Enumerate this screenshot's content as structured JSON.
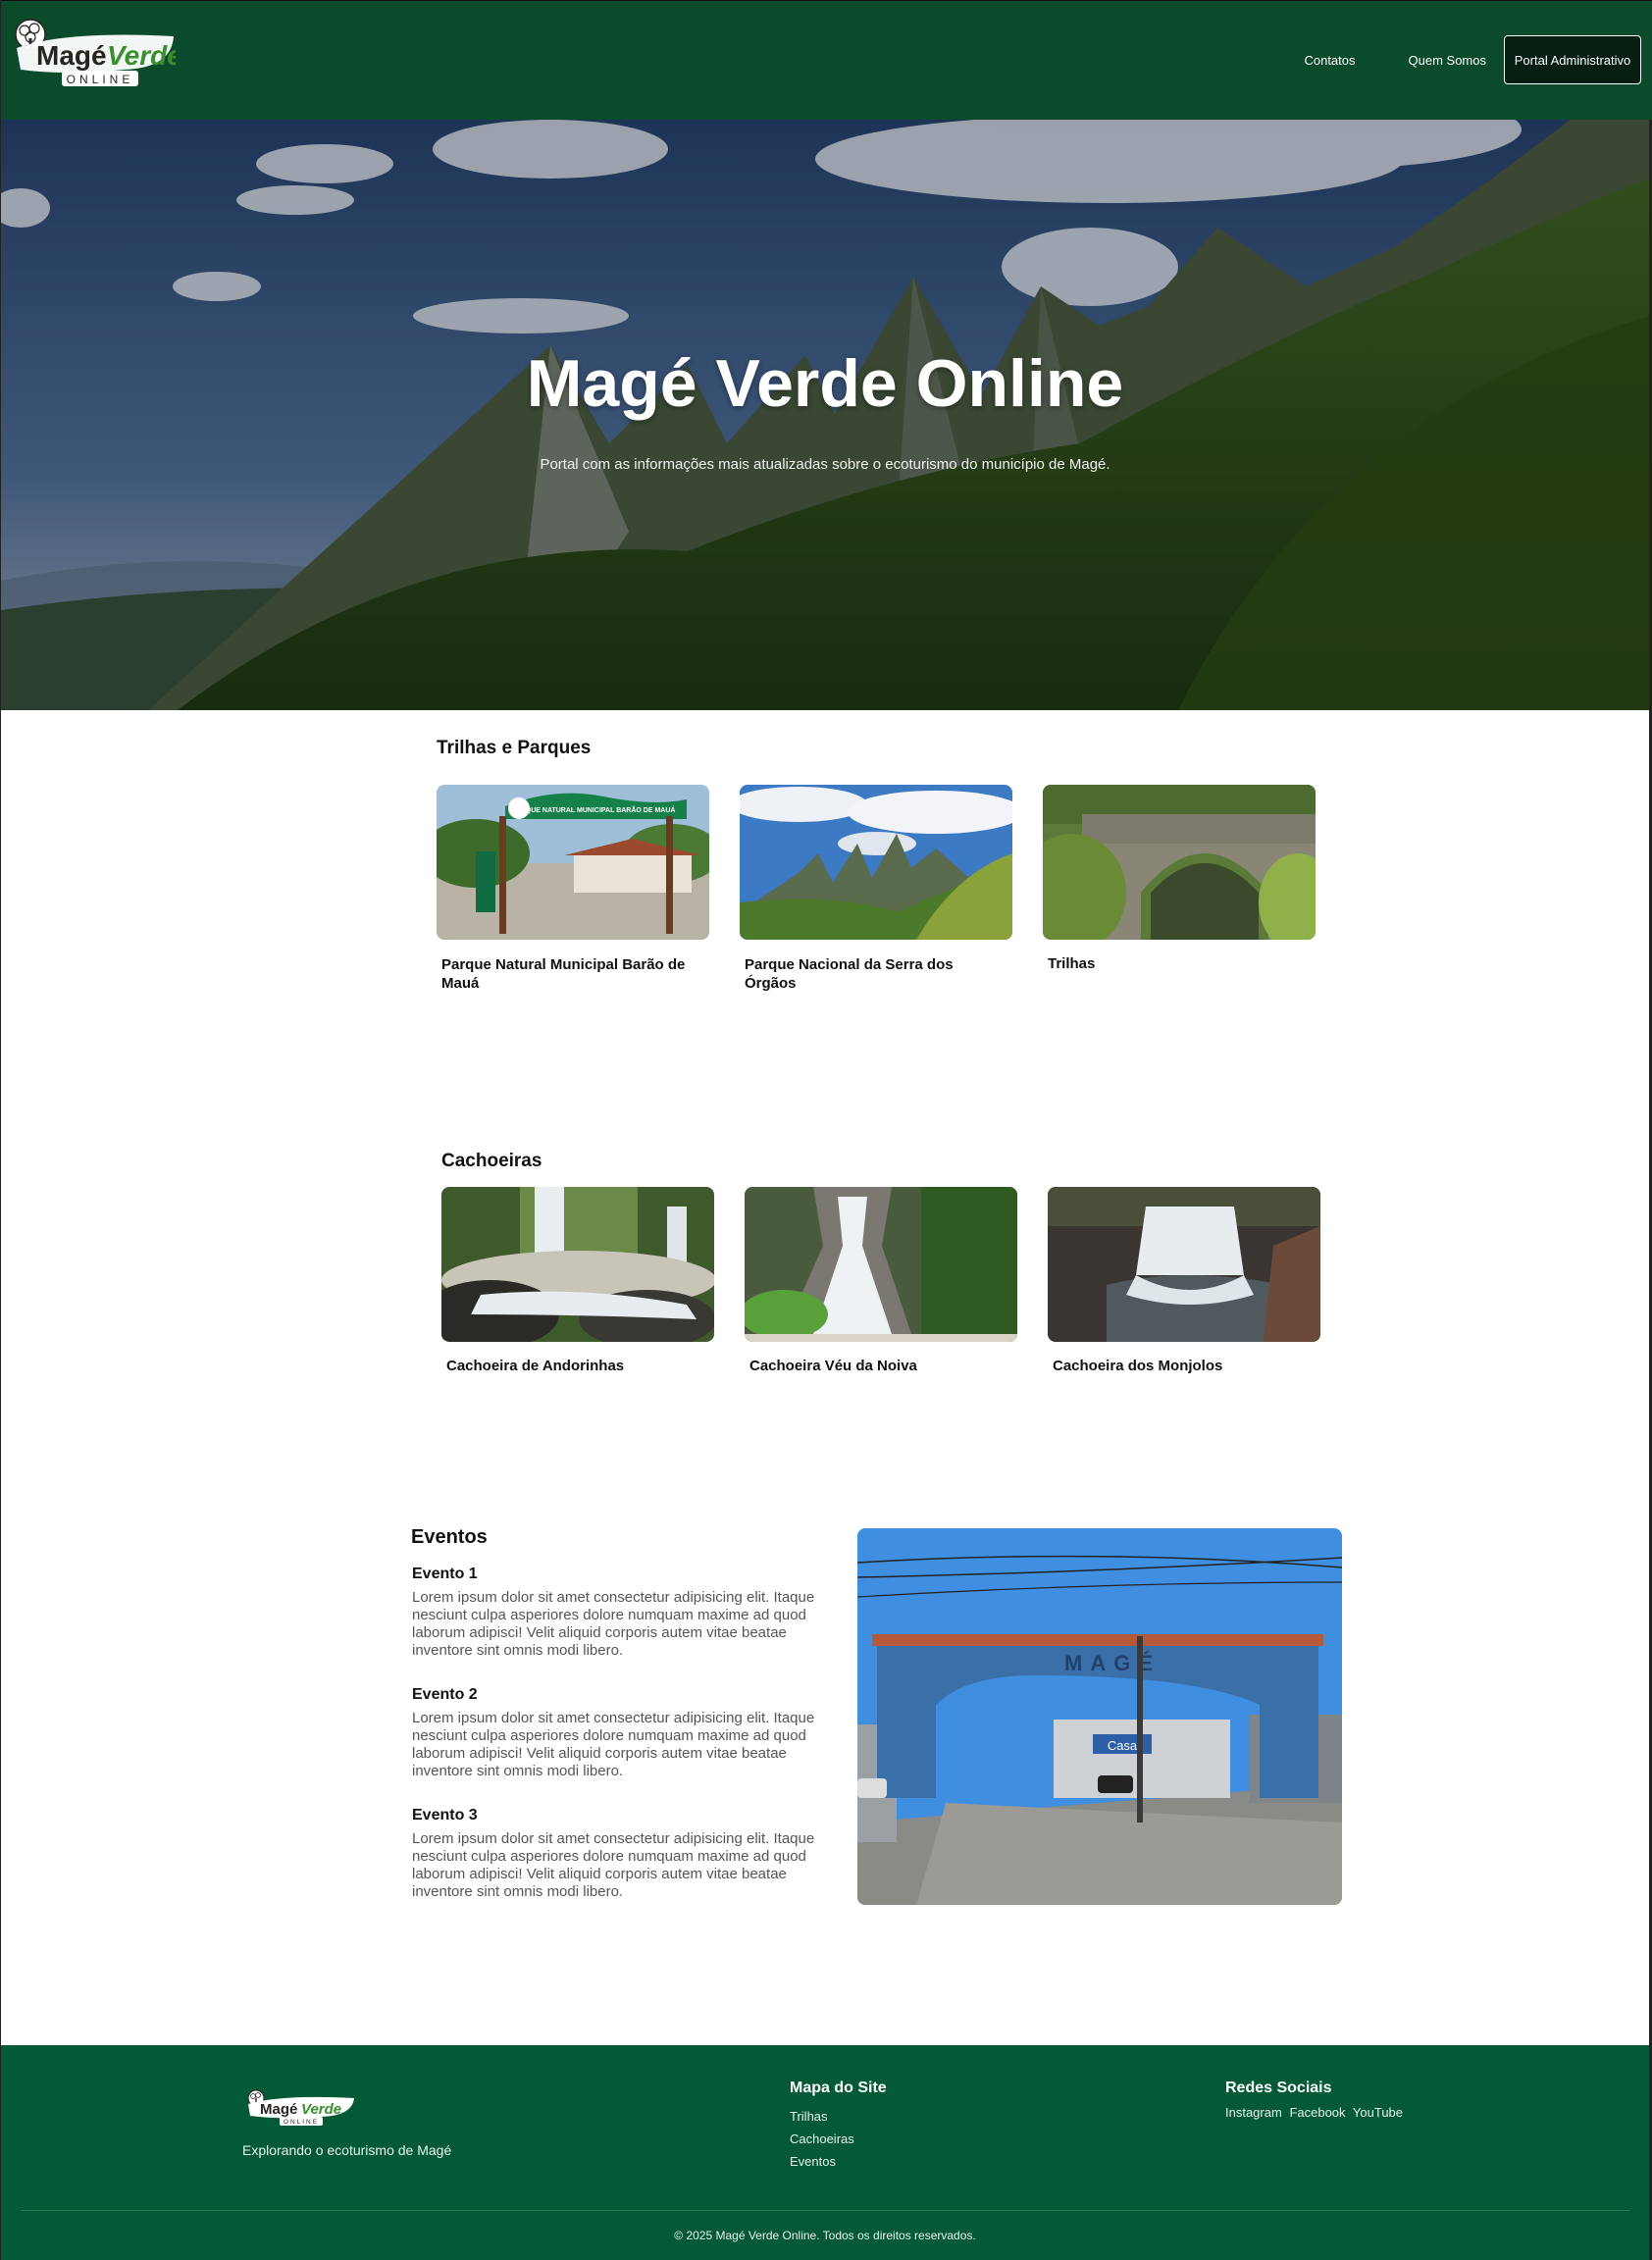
{
  "brand": {
    "logo_word_1": "Magé",
    "logo_word_2": "Verde",
    "logo_word_3": "ONLINE"
  },
  "nav": {
    "items": [
      {
        "label": "Contatos"
      },
      {
        "label": "Quem Somos"
      }
    ],
    "portal_label": "Portal Administrativo"
  },
  "hero": {
    "title": "Magé Verde Online",
    "subtitle": "Portal com as informações mais atualizadas sobre o ecoturismo do município de Magé."
  },
  "trilhas": {
    "title": "Trilhas e Parques",
    "cards": [
      {
        "caption": "Parque Natural Municipal Barão de Mauá",
        "sign_text": "PARQUE NATURAL MUNICIPAL BARÃO DE MAUÁ"
      },
      {
        "caption": "Parque Nacional da Serra dos Órgãos"
      },
      {
        "caption": "Trilhas"
      }
    ]
  },
  "cachoeiras": {
    "title": "Cachoeiras",
    "cards": [
      {
        "caption": "Cachoeira de Andorinhas"
      },
      {
        "caption": "Cachoeira Véu da Noiva"
      },
      {
        "caption": "Cachoeira dos Monjolos"
      }
    ]
  },
  "eventos": {
    "title": "Eventos",
    "items": [
      {
        "title": "Evento 1",
        "text": "Lorem ipsum dolor sit amet consectetur adipisicing elit. Itaque nesciunt culpa asperiores dolore numquam maxime ad quod laborum adipisci! Velit aliquid corporis autem vitae beatae inventore sint omnis modi libero."
      },
      {
        "title": "Evento 2",
        "text": "Lorem ipsum dolor sit amet consectetur adipisicing elit. Itaque nesciunt culpa asperiores dolore numquam maxime ad quod laborum adipisci! Velit aliquid corporis autem vitae beatae inventore sint omnis modi libero."
      },
      {
        "title": "Evento 3",
        "text": "Lorem ipsum dolor sit amet consectetur adipisicing elit. Itaque nesciunt culpa asperiores dolore numquam maxime ad quod laborum adipisci! Velit aliquid corporis autem vitae beatae inventore sint omnis modi libero."
      }
    ],
    "arch_text": "MAGÉ",
    "shop_sign": "Casa"
  },
  "footer": {
    "tagline": "Explorando o ecoturismo de Magé",
    "sitemap_title": "Mapa do Site",
    "sitemap_links": [
      {
        "label": "Trilhas"
      },
      {
        "label": "Cachoeiras"
      },
      {
        "label": "Eventos"
      }
    ],
    "social_title": "Redes Sociais",
    "social_links": [
      {
        "label": "Instagram"
      },
      {
        "label": "Facebook"
      },
      {
        "label": "YouTube"
      }
    ],
    "copyright": "© 2025 Magé Verde Online. Todos os direitos reservados."
  },
  "colors": {
    "header_bg": "#0c4a2c",
    "footer_bg": "#045a37",
    "portal_button_bg": "#061f12",
    "logo_green": "#3b8e2e",
    "logo_dark": "#2a2420"
  }
}
